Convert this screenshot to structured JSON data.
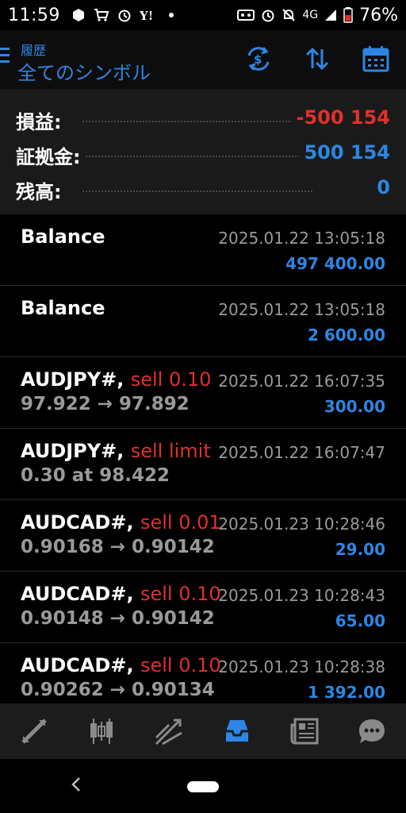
{
  "status_bar": {
    "time": "11:59",
    "network": "4G",
    "battery": "76%",
    "left_icons": [
      "app-icon",
      "cart-icon",
      "alarm-icon",
      "yahoo-icon",
      "dot-icon"
    ],
    "right_icons": [
      "voicemail-icon",
      "alarm-icon",
      "mute-icon",
      "signal-icon",
      "battery-icon"
    ]
  },
  "toolbar": {
    "subtitle": "履歴",
    "title": "全てのシンボル",
    "icons": [
      "currency-exchange-icon",
      "sort-icon",
      "calendar-icon"
    ]
  },
  "summary": {
    "profit_label": "損益:",
    "profit_value": "-500 154",
    "deposit_label": "証拠金:",
    "deposit_value": "500 154",
    "balance_label": "残高:",
    "balance_value": "0"
  },
  "history": [
    {
      "title": "Balance",
      "type": "",
      "sub": "",
      "time": "2025.01.22 13:05:18",
      "amount": "497 400.00"
    },
    {
      "title": "Balance",
      "type": "",
      "sub": "",
      "time": "2025.01.22 13:05:18",
      "amount": "2 600.00"
    },
    {
      "title": "AUDJPY#,",
      "type": "sell 0.10",
      "sub": "97.922 → 97.892",
      "time": "2025.01.22 16:07:35",
      "amount": "300.00"
    },
    {
      "title": "AUDJPY#,",
      "type": "sell limit",
      "sub": "0.30 at 98.422",
      "time": "2025.01.22 16:07:47",
      "amount": ""
    },
    {
      "title": "AUDCAD#,",
      "type": "sell 0.01",
      "sub": "0.90168 → 0.90142",
      "time": "2025.01.23 10:28:46",
      "amount": "29.00"
    },
    {
      "title": "AUDCAD#,",
      "type": "sell 0.10",
      "sub": "0.90148 → 0.90142",
      "time": "2025.01.23 10:28:43",
      "amount": "65.00"
    },
    {
      "title": "AUDCAD#,",
      "type": "sell 0.10",
      "sub": "0.90262 → 0.90134",
      "time": "2025.01.23 10:28:38",
      "amount": "1 392.00"
    }
  ],
  "bottom_nav": [
    {
      "icon": "quotes-icon",
      "active": false
    },
    {
      "icon": "chart-icon",
      "active": false
    },
    {
      "icon": "trade-icon",
      "active": false
    },
    {
      "icon": "history-icon",
      "active": true
    },
    {
      "icon": "news-icon",
      "active": false
    },
    {
      "icon": "chat-icon",
      "active": false
    }
  ],
  "colors": {
    "accent": "#2d86e4",
    "loss": "#e0302a",
    "muted": "#9a9a9a"
  }
}
